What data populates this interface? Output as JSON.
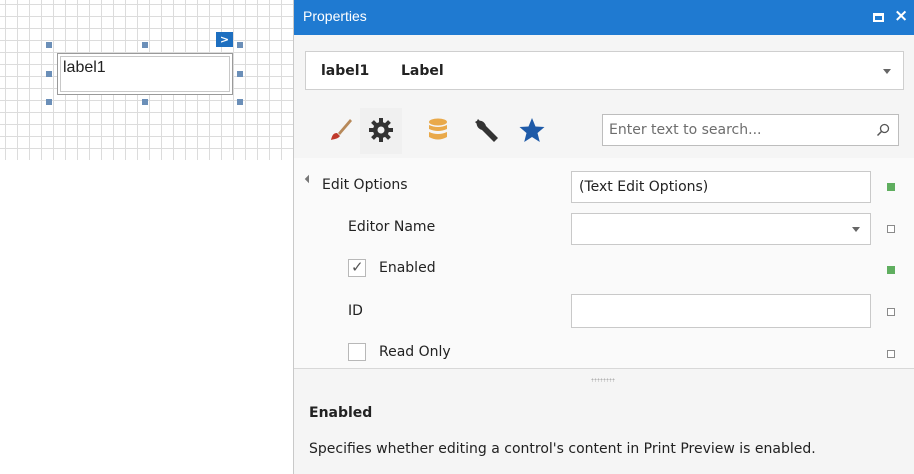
{
  "design_surface": {
    "control_text": "label1",
    "smart_tag_glyph": ">"
  },
  "properties_panel": {
    "title": "Properties",
    "title_bar_color": "#1f7ad1",
    "maximize_icon": "maximize-icon",
    "close_glyph": "×",
    "object_selector": {
      "name": "label1",
      "type": "Label"
    },
    "toolbar": {
      "icons": [
        "brush-icon",
        "gear-icon",
        "database-icon",
        "wrench-icon",
        "star-icon"
      ],
      "selected": "gear-icon"
    },
    "search": {
      "placeholder": "Enter text to search...",
      "value": ""
    },
    "rows": [
      {
        "label": "Edit Options",
        "value": "(Text Edit Options)",
        "kind": "category",
        "expanded": true,
        "marker": "set"
      },
      {
        "label": "Editor Name",
        "value": "",
        "kind": "dropdown",
        "marker": "default"
      },
      {
        "label": "Enabled",
        "kind": "checkbox",
        "checked": true,
        "marker": "set"
      },
      {
        "label": "ID",
        "value": "",
        "kind": "text",
        "marker": "default"
      },
      {
        "label": "Read Only",
        "kind": "checkbox",
        "checked": false,
        "marker": "default"
      }
    ],
    "description": {
      "title": "Enabled",
      "text": "Specifies whether editing a control's content in Print Preview is enabled."
    },
    "colors": {
      "set_marker": "#5fae5f",
      "star": "#1e5aa8",
      "database": "#e9a94a",
      "brush_tip": "#c0392b"
    }
  }
}
